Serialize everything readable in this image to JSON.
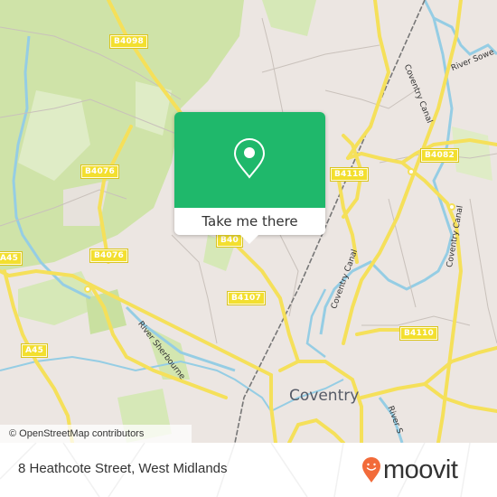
{
  "map": {
    "city_label": "Coventry",
    "attribution": "© OpenStreetMap contributors",
    "road_shields": [
      "B4098",
      "B4076",
      "B4076",
      "A45",
      "A45",
      "B4118",
      "B4082",
      "B4107",
      "B4110",
      "B40"
    ],
    "water_labels": [
      "River Sowe",
      "Coventry Canal",
      "River Sherbourne",
      "Coventry Canal",
      "Coventry Canal",
      "River S"
    ],
    "colors": {
      "land": "#ece6e2",
      "park": "#cfe3a8",
      "water": "#95cde4",
      "road": "#f5e05a",
      "rail": "#777777"
    }
  },
  "popup": {
    "icon": "map-pin-icon",
    "action_label": "Take me there",
    "accent": "#1fb86b"
  },
  "footer": {
    "address": "8 Heathcote Street, West Midlands",
    "brand": "moovit",
    "brand_icon": "moovit-pin-smile-icon",
    "brand_color": "#f26b3a"
  }
}
